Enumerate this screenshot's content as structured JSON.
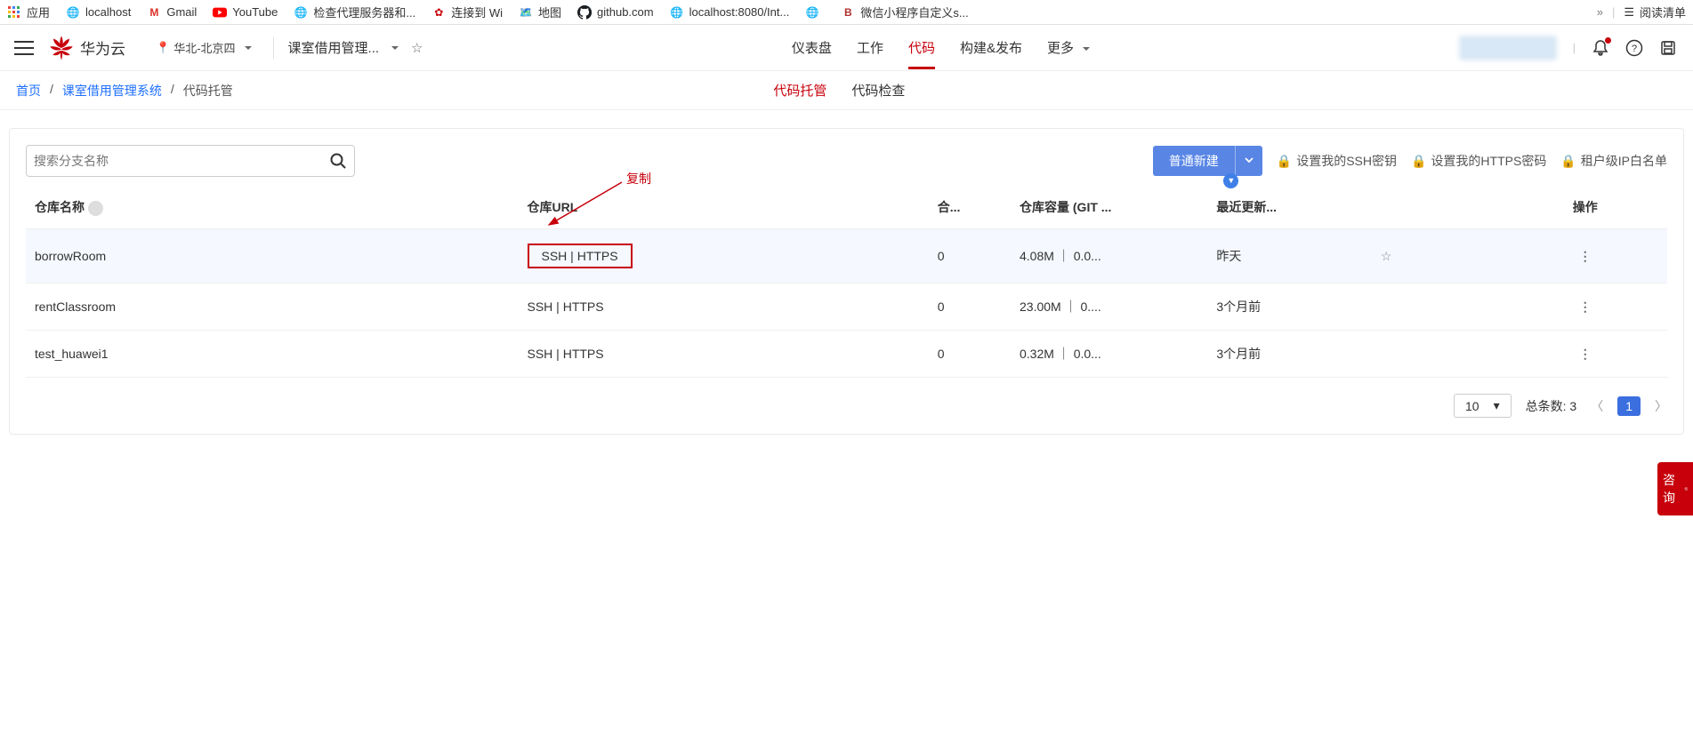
{
  "bookmarks": {
    "apps": "应用",
    "items": [
      {
        "label": "localhost",
        "icon": "globe"
      },
      {
        "label": "Gmail",
        "icon": "gmail"
      },
      {
        "label": "YouTube",
        "icon": "youtube"
      },
      {
        "label": "检查代理服务器和...",
        "icon": "globe"
      },
      {
        "label": "连接到 Wi",
        "icon": "huawei"
      },
      {
        "label": "地图",
        "icon": "map"
      },
      {
        "label": "github.com",
        "icon": "github"
      },
      {
        "label": "localhost:8080/Int...",
        "icon": "globe"
      },
      {
        "label": "",
        "icon": "globe"
      },
      {
        "label": "微信小程序自定义s...",
        "icon": "jd"
      }
    ],
    "more_icon": "»",
    "reading_list": "阅读清单"
  },
  "header": {
    "brand": "华为云",
    "region": "华北-北京四",
    "project": "课室借用管理...",
    "tabs": [
      "仪表盘",
      "工作",
      "代码",
      "构建&发布",
      "更多"
    ],
    "active_tab": "代码"
  },
  "breadcrumb": {
    "home": "首页",
    "project": "课室借用管理系统",
    "current": "代码托管"
  },
  "sub_tabs": {
    "items": [
      "代码托管",
      "代码检查"
    ],
    "active": "代码托管"
  },
  "toolbar": {
    "search_placeholder": "搜索分支名称",
    "create_btn": "普通新建",
    "ssh_key": "设置我的SSH密钥",
    "https_pwd": "设置我的HTTPS密码",
    "ip_whitelist": "租户级IP白名单"
  },
  "annotation": {
    "label": "复制"
  },
  "table": {
    "headers": {
      "name": "仓库名称",
      "url": "仓库URL",
      "merge": "合...",
      "size": "仓库容量 (GIT ...",
      "updated": "最近更新...",
      "ops": "操作"
    },
    "rows": [
      {
        "name": "borrowRoom",
        "url": "SSH | HTTPS",
        "merge": "0",
        "size": "4.08M ｜ 0.0...",
        "updated": "昨天",
        "star": true,
        "boxed": true
      },
      {
        "name": "rentClassroom",
        "url": "SSH | HTTPS",
        "merge": "0",
        "size": "23.00M ｜ 0....",
        "updated": "3个月前",
        "star": false,
        "boxed": false
      },
      {
        "name": "test_huawei1",
        "url": "SSH | HTTPS",
        "merge": "0",
        "size": "0.32M ｜ 0.0...",
        "updated": "3个月前",
        "star": false,
        "boxed": false
      }
    ]
  },
  "pagination": {
    "page_size": "10",
    "total_label": "总条数: 3",
    "current": "1"
  },
  "consult": {
    "text": "咨询"
  }
}
